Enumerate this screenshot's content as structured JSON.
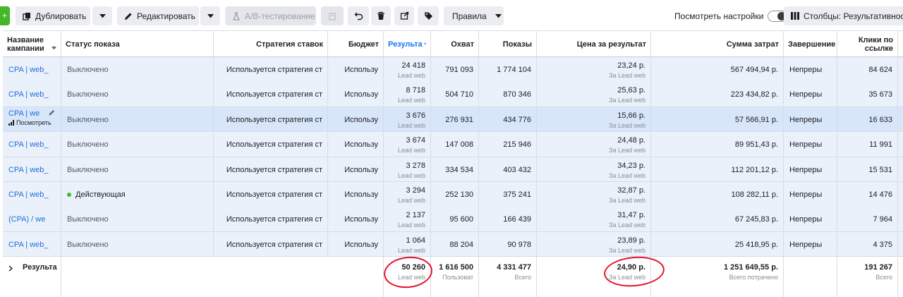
{
  "toolbar": {
    "create_label": "+",
    "duplicate_label": "Дублировать",
    "edit_label": "Редактировать",
    "ab_test_label": "A/B-тестирование",
    "rules_label": "Правила",
    "view_settings_label": "Посмотреть настройки",
    "columns_label": "Столбцы: Результативность"
  },
  "columns": {
    "name": [
      "Название",
      "кампании"
    ],
    "status": "Статус показа",
    "bid": "Стратегия ставок",
    "budget": "Бюджет",
    "results": "Результа",
    "reach": "Охват",
    "impressions": "Показы",
    "cpr": "Цена за результат",
    "spent": "Сумма затрат",
    "ends": "Завершение",
    "clicks": [
      "Клики по",
      "ссылке"
    ]
  },
  "rows": [
    {
      "name": "CPA | web_",
      "status": "Выключено",
      "active": false,
      "bid": "Используется стратегия ст",
      "budget": "Использу",
      "results": "24 418",
      "results_sub": "Lead web",
      "reach": "791 093",
      "impressions": "1 774 104",
      "cpr": "23,24 р.",
      "cpr_sub": "За Lead web",
      "spent": "567 494,94 р.",
      "ends": "Непреры",
      "clicks": "84 624"
    },
    {
      "name": "CPA | web_",
      "status": "Выключено",
      "active": false,
      "bid": "Используется стратегия ст",
      "budget": "Использу",
      "results": "8 718",
      "results_sub": "Lead web",
      "reach": "504 710",
      "impressions": "870 346",
      "cpr": "25,63 р.",
      "cpr_sub": "За Lead web",
      "spent": "223 434,82 р.",
      "ends": "Непреры",
      "clicks": "35 673"
    },
    {
      "name": "CPA | we",
      "status": "Выключено",
      "active": false,
      "bid": "Используется стратегия ст",
      "budget": "Использу",
      "results": "3 676",
      "results_sub": "Lead web",
      "reach": "276 931",
      "impressions": "434 776",
      "cpr": "15,66 р.",
      "cpr_sub": "За Lead web",
      "spent": "57 566,91 р.",
      "ends": "Непреры",
      "clicks": "16 633",
      "view_label": "Посмотреть"
    },
    {
      "name": "CPA | web_",
      "status": "Выключено",
      "active": false,
      "bid": "Используется стратегия ст",
      "budget": "Использу",
      "results": "3 674",
      "results_sub": "Lead web",
      "reach": "147 008",
      "impressions": "215 946",
      "cpr": "24,48 р.",
      "cpr_sub": "За Lead web",
      "spent": "89 951,43 р.",
      "ends": "Непреры",
      "clicks": "11 991"
    },
    {
      "name": "CPA | web_",
      "status": "Выключено",
      "active": false,
      "bid": "Используется стратегия ст",
      "budget": "Использу",
      "results": "3 278",
      "results_sub": "Lead web",
      "reach": "334 534",
      "impressions": "403 432",
      "cpr": "34,23 р.",
      "cpr_sub": "За Lead web",
      "spent": "112 201,12 р.",
      "ends": "Непреры",
      "clicks": "15 531"
    },
    {
      "name": "CPA | web_",
      "status": "Действующая",
      "active": true,
      "bid": "Используется стратегия ст",
      "budget": "Использу",
      "results": "3 294",
      "results_sub": "Lead web",
      "reach": "252 130",
      "impressions": "375 241",
      "cpr": "32,87 р.",
      "cpr_sub": "За Lead web",
      "spent": "108 282,11 р.",
      "ends": "Непреры",
      "clicks": "14 476"
    },
    {
      "name": "(CPA) / we",
      "status": "Выключено",
      "active": false,
      "bid": "Используется стратегия ст",
      "budget": "Использу",
      "results": "2 137",
      "results_sub": "Lead web",
      "reach": "95 600",
      "impressions": "166 439",
      "cpr": "31,47 р.",
      "cpr_sub": "За Lead web",
      "spent": "67 245,83 р.",
      "ends": "Непреры",
      "clicks": "7 964"
    },
    {
      "name": "CPA | web_",
      "status": "Выключено",
      "active": false,
      "bid": "Используется стратегия ст",
      "budget": "Использу",
      "results": "1 064",
      "results_sub": "Lead web",
      "reach": "88 204",
      "impressions": "90 978",
      "cpr": "23,89 р.",
      "cpr_sub": "За Lead web",
      "spent": "25 418,95 р.",
      "ends": "Непреры",
      "clicks": "4 375"
    }
  ],
  "summary": {
    "label": "Результа",
    "results": "50 260",
    "results_sub": "Lead web",
    "reach": "1 616 500",
    "reach_sub": "Пользоват",
    "impressions": "4 331 477",
    "impressions_sub": "Всего",
    "cpr": "24,90 р.",
    "cpr_sub": "За Lead web",
    "spent": "1 251 649,55 р.",
    "spent_sub": "Всего потрачено",
    "clicks": "191 267",
    "clicks_sub": "Всего"
  },
  "colors": {
    "accent": "#1877f2",
    "active_dot": "#42b72a",
    "annotation": "#e3122d",
    "row_bg": "#eaf1fb",
    "selected_row_bg": "#d8e6fa"
  }
}
